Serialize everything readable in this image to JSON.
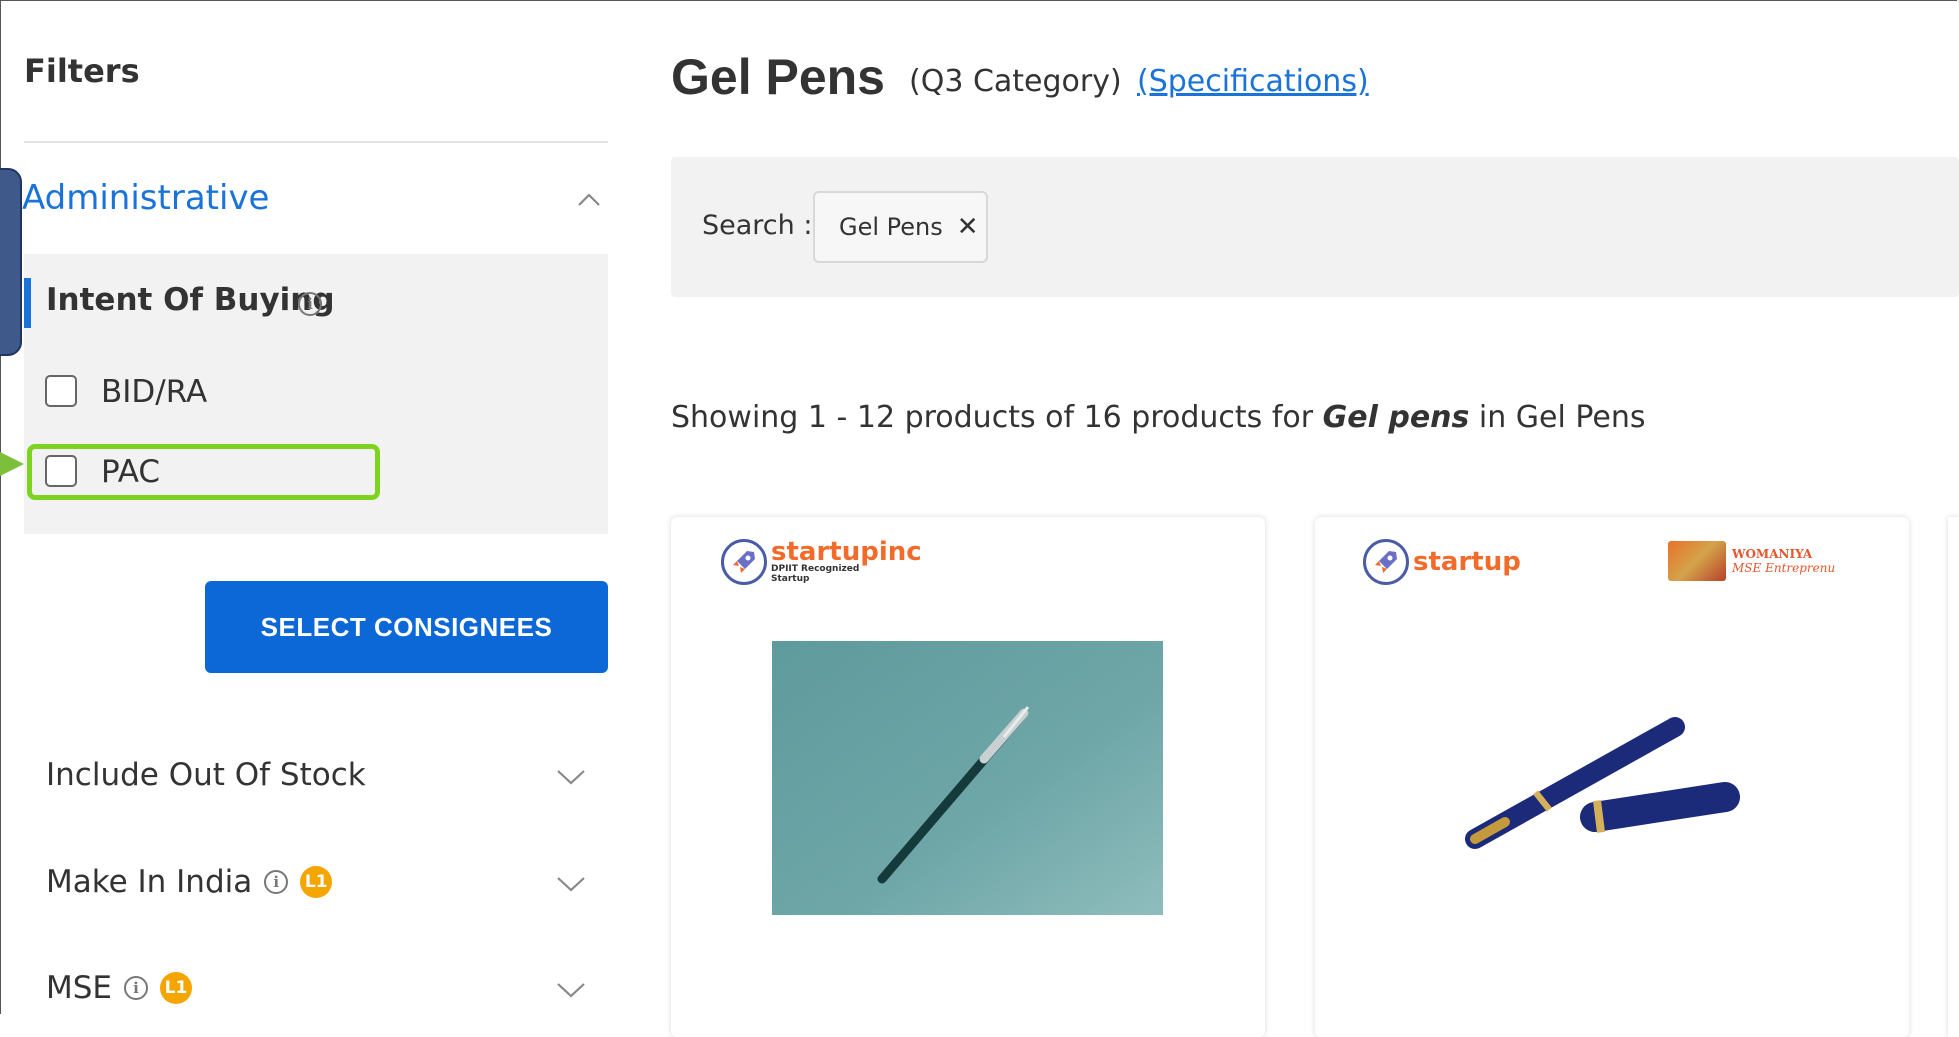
{
  "sidebar": {
    "title": "Filters",
    "section_title": "Administrative",
    "intent_label": "Intent Of Buying",
    "options": [
      {
        "label": "BID/RA",
        "checked": false
      },
      {
        "label": "PAC",
        "checked": false
      }
    ],
    "select_button": "SELECT CONSIGNEES",
    "filters": [
      {
        "label": "Include Out Of Stock",
        "info": false,
        "badge": ""
      },
      {
        "label": "Make In India",
        "info": true,
        "badge": "L1"
      },
      {
        "label": "MSE",
        "info": true,
        "badge": "L1"
      }
    ]
  },
  "main": {
    "title": "Gel Pens",
    "category": "(Q3 Category)",
    "specifications_link": "(Specifications)",
    "search_label": "Search :",
    "search_chip": "Gel Pens",
    "showing_prefix": "Showing 1 - 12 products of 16 products for",
    "showing_term": "Gel pens",
    "showing_suffix": "in Gel Pens"
  },
  "cards": [
    {
      "startup_label": "startupinc",
      "startup_sub1": "DPIIT Recognized",
      "startup_sub2": "Startup"
    },
    {
      "startup_label": "startup",
      "womaniya_line1": "WOMANIYA",
      "womaniya_line2": "MSE Entreprenu"
    }
  ],
  "colors": {
    "accent": "#1a73d9",
    "button": "#0b68d6",
    "highlight": "#7ed321",
    "badge": "#f5a500",
    "startup_orange": "#f26b2a"
  }
}
